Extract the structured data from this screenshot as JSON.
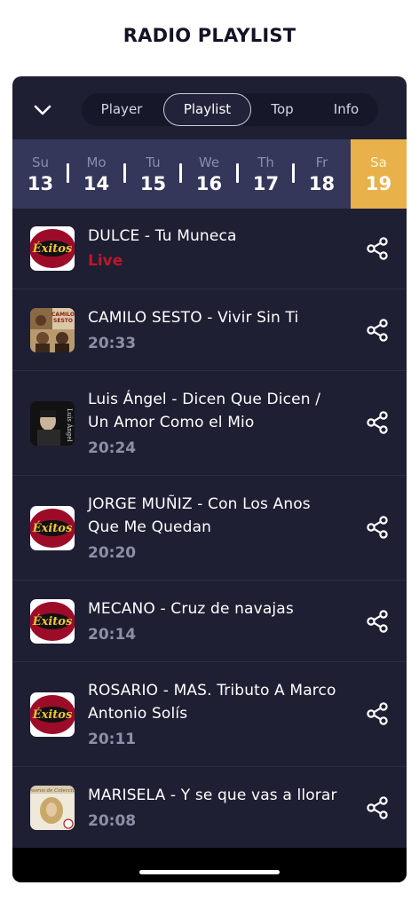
{
  "page_title": "RADIO PLAYLIST",
  "tabs": [
    {
      "label": "Player",
      "active": false
    },
    {
      "label": "Playlist",
      "active": true
    },
    {
      "label": "Top",
      "active": false
    },
    {
      "label": "Info",
      "active": false
    }
  ],
  "days": [
    {
      "name": "Su",
      "num": "13"
    },
    {
      "name": "Mo",
      "num": "14"
    },
    {
      "name": "Tu",
      "num": "15"
    },
    {
      "name": "We",
      "num": "16"
    },
    {
      "name": "Th",
      "num": "17"
    },
    {
      "name": "Fr",
      "num": "18"
    },
    {
      "name": "Sa",
      "num": "19",
      "active": true
    }
  ],
  "tracks": [
    {
      "title": "DULCE - Tu Muneca",
      "time": "Live",
      "live": true,
      "cover": "station-logo"
    },
    {
      "title": "CAMILO SESTO - Vivir Sin Ti",
      "time": "20:33",
      "cover": "camilo-cover"
    },
    {
      "title": "Luis Ángel - Dicen Que Dicen / Un Amor Como el Mio",
      "time": "20:24",
      "cover": "luis-cover"
    },
    {
      "title": "JORGE MUÑIZ - Con Los Anos Que Me Quedan",
      "time": "20:20",
      "cover": "station-logo"
    },
    {
      "title": "MECANO - Cruz de navajas",
      "time": "20:14",
      "cover": "station-logo"
    },
    {
      "title": "ROSARIO - MAS. Tributo A Marco Antonio Solís",
      "time": "20:11",
      "cover": "station-logo"
    },
    {
      "title": "MARISELA - Y se que vas a llorar",
      "time": "20:08",
      "cover": "marisela-cover"
    }
  ],
  "station_logo_text": "Éxitos",
  "colors": {
    "panel": "#1e1f33",
    "day_strip": "#34365a",
    "active_day": "#e8b14a",
    "live": "#c0162a",
    "time": "#8d8fa8"
  },
  "icons": {
    "collapse": "chevron-down-icon",
    "share": "share-icon"
  }
}
